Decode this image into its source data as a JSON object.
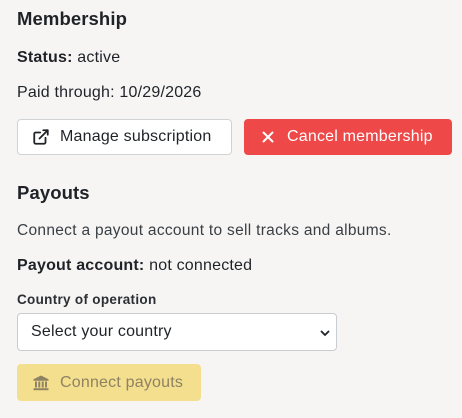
{
  "membership": {
    "title": "Membership",
    "status_label": "Status:",
    "status_value": "active",
    "paid_through": "Paid through: 10/29/2026",
    "manage_label": "Manage subscription",
    "cancel_label": "Cancel membership"
  },
  "payouts": {
    "title": "Payouts",
    "description": "Connect a payout account to sell tracks and albums.",
    "account_label": "Payout account:",
    "account_value": "not connected",
    "country_label": "Country of operation",
    "country_selected": "Select your country",
    "connect_label": "Connect payouts"
  },
  "icons": {
    "manage": "external-link-icon",
    "cancel": "close-icon",
    "connect": "bank-icon",
    "select": "chevron-down-icon"
  },
  "colors": {
    "cancel_bg": "#ee4848",
    "connect_bg": "#f3df8e",
    "connect_text": "#8e8262"
  }
}
